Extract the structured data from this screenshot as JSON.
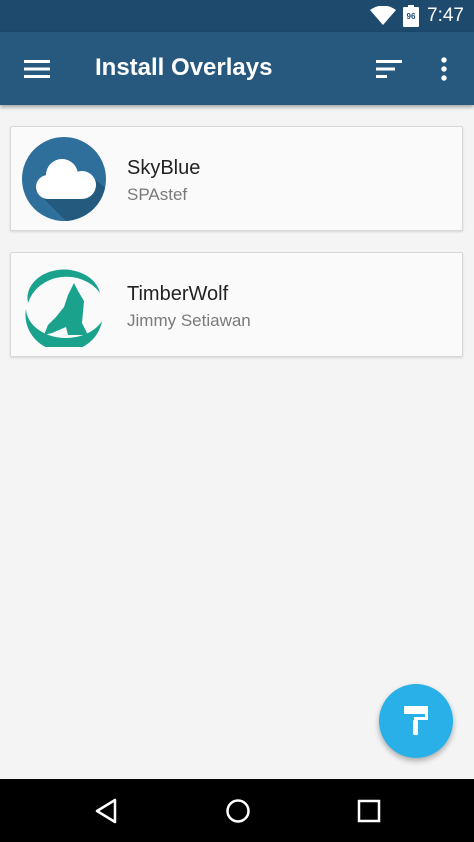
{
  "status_bar": {
    "time": "7:47",
    "battery_level": "96"
  },
  "app_bar": {
    "title": "Install Overlays",
    "menu_icon": "menu-icon",
    "sort_icon": "sort-icon",
    "more_icon": "more-vert-icon"
  },
  "overlays": [
    {
      "name": "SkyBlue",
      "author": "SPAstef",
      "icon": "cloud-icon"
    },
    {
      "name": "TimberWolf",
      "author": "Jimmy Setiawan",
      "icon": "howling-wolf-icon"
    }
  ],
  "fab": {
    "icon": "paint-roller-icon"
  },
  "colors": {
    "status_bar": "#1e4a6e",
    "app_bar": "#27597f",
    "fab": "#29b0e8",
    "skyblue_logo": "#2e6f9c",
    "timberwolf_logo": "#1aa28c"
  }
}
